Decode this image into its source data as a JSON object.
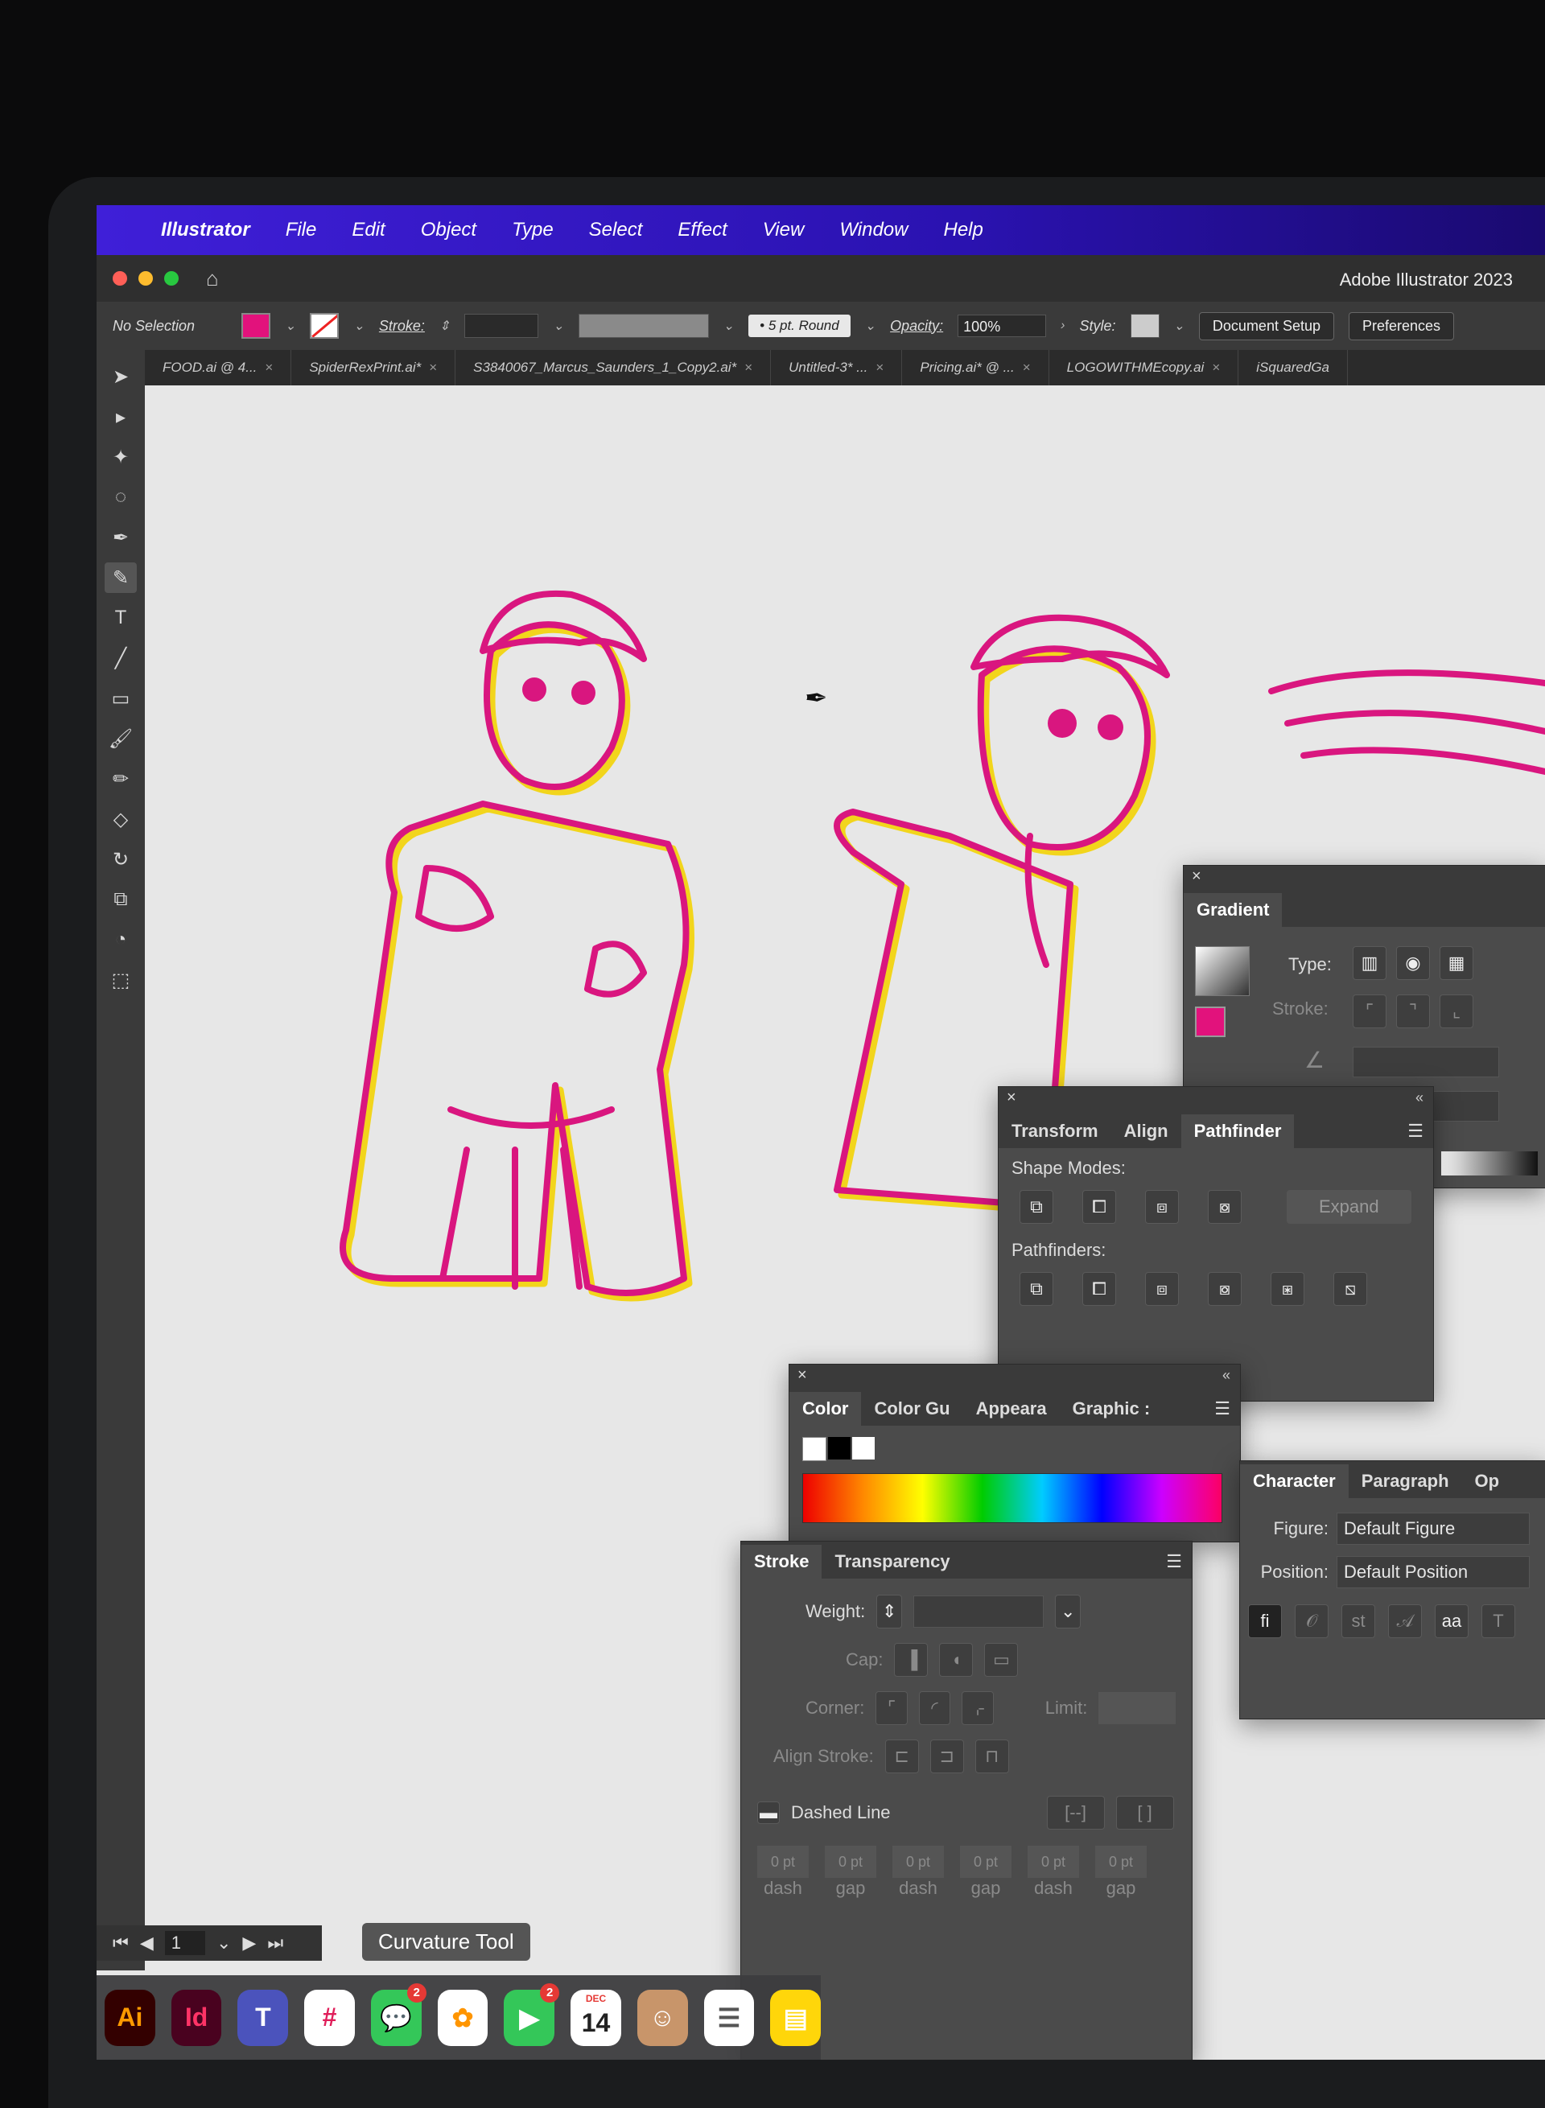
{
  "menubar": {
    "app_name": "Illustrator",
    "items": [
      "File",
      "Edit",
      "Object",
      "Type",
      "Select",
      "Effect",
      "View",
      "Window",
      "Help"
    ]
  },
  "control_bar": {
    "selection_status": "No Selection",
    "stroke_label": "Stroke:",
    "brush_value": "5 pt. Round",
    "opacity_label": "Opacity:",
    "opacity_value": "100%",
    "style_label": "Style:",
    "document_setup": "Document Setup",
    "preferences": "Preferences",
    "app_version": "Adobe Illustrator 2023",
    "fill_color": "#e2127c"
  },
  "doc_tabs": [
    {
      "label": "FOOD.ai @ 4..."
    },
    {
      "label": "SpiderRexPrint.ai*"
    },
    {
      "label": "S3840067_Marcus_Saunders_1_Copy2.ai*"
    },
    {
      "label": "Untitled-3* ..."
    },
    {
      "label": "Pricing.ai* @ ..."
    },
    {
      "label": "LOGOWITHMEcopy.ai"
    },
    {
      "label": "iSquaredGa"
    }
  ],
  "gradient_panel": {
    "title": "Gradient",
    "type_label": "Type:",
    "stroke_label": "Stroke:"
  },
  "pathfinder_panel": {
    "tabs": [
      "Transform",
      "Align",
      "Pathfinder"
    ],
    "shape_modes_label": "Shape Modes:",
    "pathfinders_label": "Pathfinders:",
    "expand_label": "Expand"
  },
  "color_panel": {
    "tabs": [
      "Color",
      "Color Gu",
      "Appeara",
      "Graphic :"
    ]
  },
  "stroke_panel": {
    "tabs": [
      "Stroke",
      "Transparency"
    ],
    "weight_label": "Weight:",
    "cap_label": "Cap:",
    "corner_label": "Corner:",
    "limit_label": "Limit:",
    "align_stroke_label": "Align Stroke:",
    "dashed_line_label": "Dashed Line",
    "dash_fields": [
      {
        "value": "0 pt",
        "label": "dash"
      },
      {
        "value": "0 pt",
        "label": "gap"
      },
      {
        "value": "0 pt",
        "label": "dash"
      },
      {
        "value": "0 pt",
        "label": "gap"
      },
      {
        "value": "0 pt",
        "label": "dash"
      },
      {
        "value": "0 pt",
        "label": "gap"
      }
    ]
  },
  "character_panel": {
    "tabs": [
      "Character",
      "Paragraph",
      "Op"
    ],
    "figure_label": "Figure:",
    "figure_value": "Default Figure",
    "position_label": "Position:",
    "position_value": "Default Position"
  },
  "tooltip": "Curvature Tool",
  "page_number": "1",
  "dock": {
    "apps": [
      {
        "name": "Illustrator",
        "glyph": "Ai",
        "color": "#330000",
        "fg": "#ff9a00"
      },
      {
        "name": "InDesign",
        "glyph": "Id",
        "color": "#49021f",
        "fg": "#ff3366"
      },
      {
        "name": "Teams",
        "glyph": "T",
        "color": "#4b53bc",
        "fg": "#ffffff"
      },
      {
        "name": "Slack",
        "glyph": "#",
        "color": "#ffffff",
        "fg": "#e01e5a"
      },
      {
        "name": "Messages",
        "glyph": "💬",
        "color": "#34c759",
        "fg": "#ffffff",
        "badge": "2"
      },
      {
        "name": "Photos",
        "glyph": "✿",
        "color": "#ffffff",
        "fg": "#ff9500"
      },
      {
        "name": "FaceTime",
        "glyph": "▶",
        "color": "#34c759",
        "fg": "#ffffff",
        "badge": "2"
      },
      {
        "name": "Calendar",
        "glyph": "14",
        "month": "DEC",
        "color": "#ffffff",
        "fg": "#222222"
      },
      {
        "name": "Contacts",
        "glyph": "☺",
        "color": "#c8956a",
        "fg": "#ffffff"
      },
      {
        "name": "Reminders",
        "glyph": "☰",
        "color": "#ffffff",
        "fg": "#555555"
      },
      {
        "name": "Notes",
        "glyph": "▤",
        "color": "#ffd60a",
        "fg": "#ffffff"
      }
    ]
  }
}
